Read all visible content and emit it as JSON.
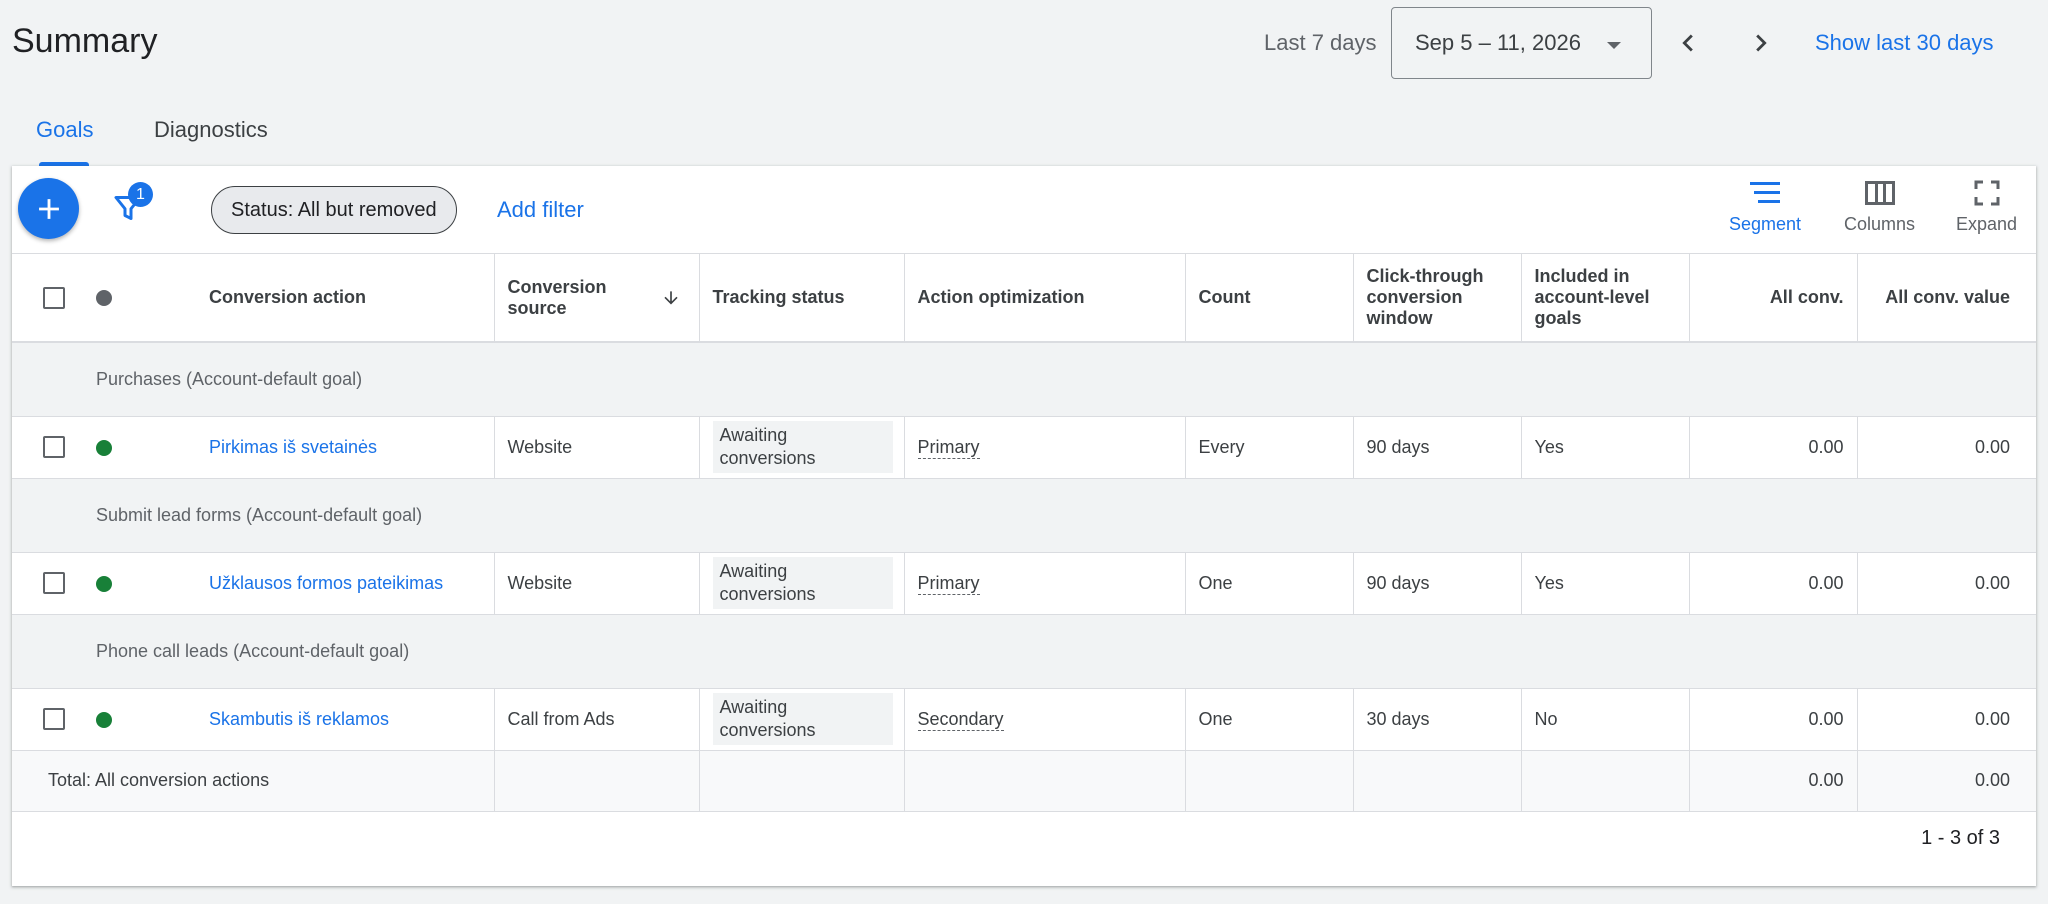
{
  "header": {
    "title": "Summary",
    "range_label": "Last 7 days",
    "date_range": "Sep 5 – 11, 2026",
    "show_last_30": "Show last 30 days"
  },
  "tabs": [
    {
      "label": "Goals",
      "active": true
    },
    {
      "label": "Diagnostics",
      "active": false
    }
  ],
  "toolbar": {
    "filter_count": "1",
    "status_chip": "Status: All but removed",
    "add_filter": "Add filter",
    "segment": "Segment",
    "columns": "Columns",
    "expand": "Expand"
  },
  "columns": {
    "conversion_action": "Conversion action",
    "conversion_source": "Conversion source",
    "tracking_status": "Tracking status",
    "action_optimization": "Action optimization",
    "count": "Count",
    "click_through": "Click-through conversion window",
    "included": "Included in account-level goals",
    "all_conv": "All conv.",
    "all_conv_value": "All conv. value"
  },
  "groups": [
    {
      "label": "Purchases (Account-default goal)",
      "row": {
        "name": "Pirkimas iš svetainės",
        "source": "Website",
        "tracking": "Awaiting conversions",
        "optimization": "Primary",
        "count": "Every",
        "window": "90 days",
        "included": "Yes",
        "all_conv": "0.00",
        "all_conv_value": "0.00"
      }
    },
    {
      "label": "Submit lead forms (Account-default goal)",
      "row": {
        "name": "Užklausos formos pateikimas",
        "source": "Website",
        "tracking": "Awaiting conversions",
        "optimization": "Primary",
        "count": "One",
        "window": "90 days",
        "included": "Yes",
        "all_conv": "0.00",
        "all_conv_value": "0.00"
      }
    },
    {
      "label": "Phone call leads (Account-default goal)",
      "row": {
        "name": "Skambutis iš reklamos",
        "source": "Call from Ads",
        "tracking": "Awaiting conversions",
        "optimization": "Secondary",
        "count": "One",
        "window": "30 days",
        "included": "No",
        "all_conv": "0.00",
        "all_conv_value": "0.00"
      }
    }
  ],
  "total": {
    "label": "Total: All conversion actions",
    "all_conv": "0.00",
    "all_conv_value": "0.00"
  },
  "pagination": "1 - 3 of 3",
  "colors": {
    "accent": "#1a73e8",
    "status_green": "#188038"
  }
}
